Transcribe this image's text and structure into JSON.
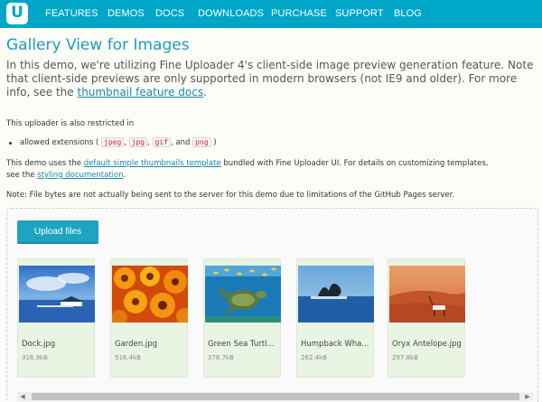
{
  "nav": {
    "items": [
      "FEATURES",
      "DEMOS",
      "DOCS",
      "DOWNLOADS",
      "PURCHASE",
      "SUPPORT",
      "BLOG"
    ]
  },
  "page": {
    "title": "Gallery View for Images",
    "intro_text": "In this demo, we're utilizing Fine Uploader 4's client-side image preview generation feature. Note that client-side previews are only supported in modern browsers (not IE9 and older). For more info, see the ",
    "intro_link": "thumbnail feature docs",
    "intro_end": ".",
    "restricted_text": "This uploader is also restricted in",
    "extensions_prefix": "allowed extensions (",
    "extensions": [
      "jpeg",
      "jpg",
      "gif",
      "png"
    ],
    "extensions_and": "and",
    "extensions_suffix": ")",
    "template_text_1": "This demo uses the ",
    "template_link": "default simple thumbnails template",
    "template_text_2": " bundled with Fine Uploader UI. For details on customizing templates,",
    "styling_text_1": "see the ",
    "styling_link": "styling documentation",
    "styling_text_2": ".",
    "note_text": "Note: File bytes are not actually being sent to the server for this demo due to limitations of the GitHub Pages server."
  },
  "uploader": {
    "button_label": "Upload files",
    "files": [
      {
        "name": "Dock.jpg",
        "size": "316.9kB"
      },
      {
        "name": "Garden.jpg",
        "size": "516.4kB"
      },
      {
        "name": "Green Sea Turtl...",
        "size": "378.7kB"
      },
      {
        "name": "Humpback Wha...",
        "size": "262.4kB"
      },
      {
        "name": "Oryx Antelope.jpg",
        "size": "297.8kB"
      }
    ]
  },
  "colors": {
    "brand": "#00a6c7",
    "title": "#1a9cc2",
    "button": "#1ea3c1",
    "card": "#e9f4e2"
  }
}
